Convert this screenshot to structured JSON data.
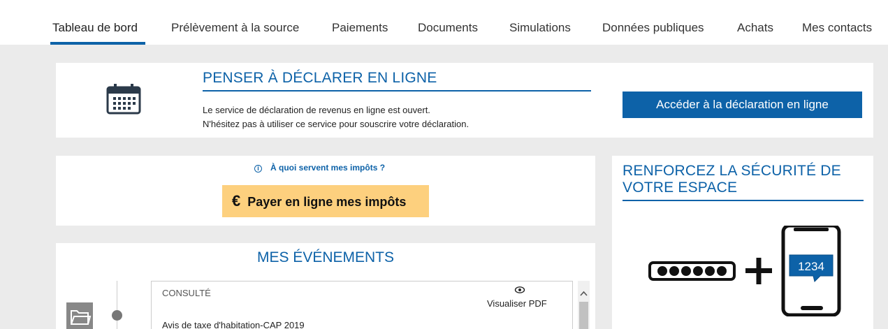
{
  "nav": {
    "tabs": [
      {
        "label": "Tableau de bord",
        "active": true
      },
      {
        "label": "Prélèvement à la source"
      },
      {
        "label": "Paiements"
      },
      {
        "label": "Documents"
      },
      {
        "label": "Simulations"
      },
      {
        "label": "Données publiques"
      },
      {
        "label": "Achats"
      },
      {
        "label": "Mes contacts"
      }
    ]
  },
  "declare": {
    "icon": "calendar-icon",
    "title": "PENSER À DÉCLARER EN LIGNE",
    "line1": "Le service de déclaration de revenus en ligne est ouvert.",
    "line2": "N'hésitez pas à utiliser ce service pour souscrire votre déclaration.",
    "button": "Accéder à la déclaration en ligne"
  },
  "pay": {
    "info_icon": "info-icon",
    "info_link": "À quoi servent mes impôts ?",
    "button_symbol": "€",
    "button": "Payer en ligne mes impôts"
  },
  "events": {
    "title": "MES ÉVÉNEMENTS",
    "item": {
      "status": "CONSULTÉ",
      "action": "Visualiser  PDF",
      "title": "Avis de taxe d'habitation-CAP 2019",
      "icon": "folder-icon"
    }
  },
  "security": {
    "title": "RENFORCEZ LA SÉCURITÉ DE VOTRE ESPACE",
    "code": "1234"
  },
  "colors": {
    "brand_blue": "#0d62a8",
    "pay_yellow": "#fdd07e",
    "background": "#ebebeb"
  }
}
